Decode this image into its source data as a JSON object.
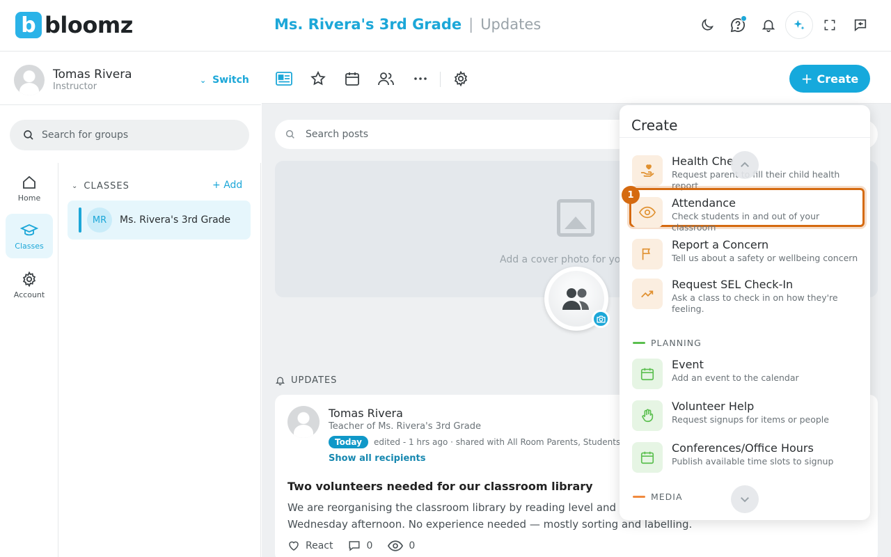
{
  "app": {
    "logo_text": "bloomz"
  },
  "header": {
    "class_name": "Ms. Rivera's 3rd Grade",
    "separator": "|",
    "page": "Updates"
  },
  "profile": {
    "name": "Tomas Rivera",
    "role": "Instructor",
    "switch_label": "Switch"
  },
  "groups_search": {
    "placeholder": "Search for groups"
  },
  "nav": [
    {
      "label": "Home",
      "icon": "home-icon"
    },
    {
      "label": "Classes",
      "icon": "graduation-cap-icon",
      "active": true
    },
    {
      "label": "Account",
      "icon": "gear-icon"
    }
  ],
  "classes": {
    "header": "CLASSES",
    "add_label": "Add",
    "items": [
      {
        "initials": "MR",
        "name": "Ms. Rivera's 3rd Grade"
      }
    ]
  },
  "toolbar": {
    "create_label": "Create"
  },
  "posts_search": {
    "placeholder": "Search posts"
  },
  "cover": {
    "prompt": "Add a cover photo for you"
  },
  "updates": {
    "header": "UPDATES",
    "post": {
      "author": "Tomas Rivera",
      "subtitle": "Teacher of Ms. Rivera's 3rd Grade",
      "badge": "Today",
      "meta": "edited - 1 hrs ago · shared with All Room Parents, Students",
      "show_recipients": "Show all recipients",
      "title": "Two volunteers needed for our classroom library",
      "body_line1": "We are reorganising the classroom library by reading level and c",
      "body_line2": "Wednesday afternoon. No experience needed — mostly sorting and labelling.",
      "react_label": "React",
      "comments": "0",
      "views": "0"
    }
  },
  "create_menu": {
    "title": "Create",
    "step_number": "1",
    "items": [
      {
        "label": "Health Che",
        "desc": "Request parent to fill their child health report",
        "icon": "hand-heart-icon"
      },
      {
        "label": "Attendance",
        "desc": "Check students in and out of your classroom",
        "icon": "eye-icon"
      },
      {
        "label": "Report a Concern",
        "desc": "Tell us about a safety or wellbeing concern",
        "icon": "flag-icon"
      },
      {
        "label": "Request SEL Check-In",
        "desc": "Ask a class to check in on how they're feeling.",
        "icon": "trending-up-icon"
      }
    ],
    "planning_header": "PLANNING",
    "planning": [
      {
        "label": "Event",
        "desc": "Add an event to the calendar",
        "icon": "calendar-icon"
      },
      {
        "label": "Volunteer Help",
        "desc": "Request signups for items or people",
        "icon": "hand-icon"
      },
      {
        "label": "Conferences/Office Hours",
        "desc": "Publish available time slots to signup",
        "icon": "calendar-icon"
      }
    ],
    "media_header": "MEDIA"
  },
  "colors": {
    "accent": "#1ca7d8",
    "highlight": "#d56a10",
    "planning": "#5bbf4f",
    "media": "#f08a3e"
  }
}
